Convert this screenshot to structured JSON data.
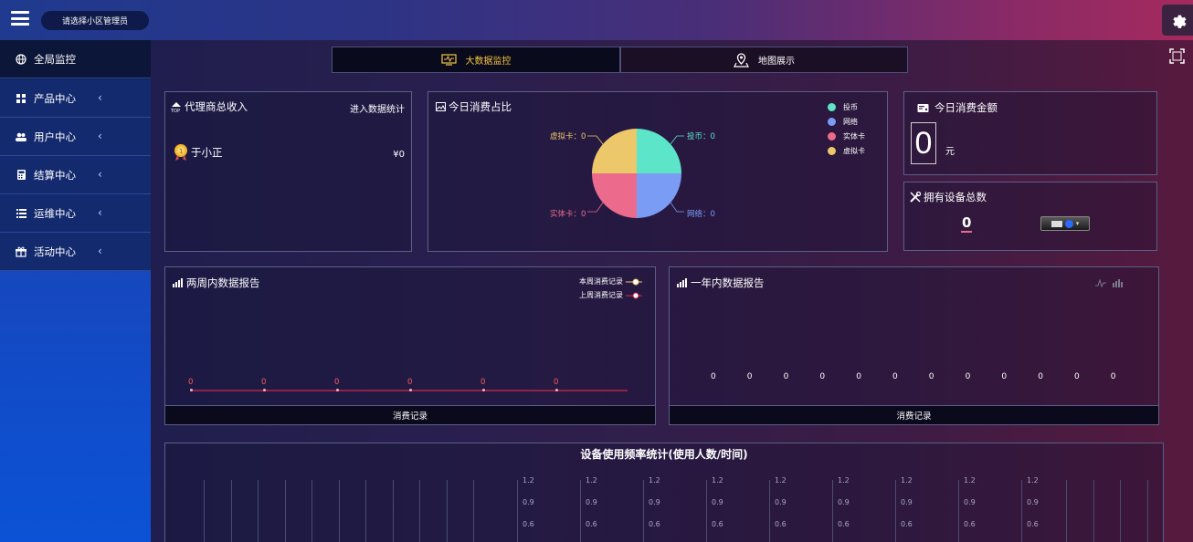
{
  "topbar": {
    "community_select": "请选择小区管理员"
  },
  "sidebar": {
    "items": [
      {
        "label": "全局监控",
        "icon": "globe-icon"
      },
      {
        "label": "产品中心",
        "icon": "grid-icon"
      },
      {
        "label": "用户中心",
        "icon": "users-icon"
      },
      {
        "label": "结算中心",
        "icon": "calculator-icon"
      },
      {
        "label": "运维中心",
        "icon": "list-icon"
      },
      {
        "label": "活动中心",
        "icon": "gift-icon"
      }
    ]
  },
  "tabs": [
    {
      "label": "大数据监控",
      "icon": "monitor-icon"
    },
    {
      "label": "地图展示",
      "icon": "map-pin-icon"
    }
  ],
  "agent_income": {
    "title": "代理商总收入",
    "link": "进入数据统计",
    "name": "于小正",
    "amount": "¥0"
  },
  "consumption_share": {
    "title": "今日消费占比",
    "legend": [
      {
        "name": "投币",
        "color": "#5ce5c8"
      },
      {
        "name": "网络",
        "color": "#7b9cf5"
      },
      {
        "name": "实体卡",
        "color": "#ec6a8c"
      },
      {
        "name": "虚拟卡",
        "color": "#ecc86a"
      }
    ],
    "labels": {
      "coin": "投币：0",
      "net": "网络：0",
      "card": "实体卡：0",
      "virtual": "虚拟卡：0"
    }
  },
  "today_amount": {
    "title": "今日消费金额",
    "value": "0",
    "unit": "元"
  },
  "device_total": {
    "title": "拥有设备总数",
    "value": "0"
  },
  "two_week": {
    "title": "两周内数据报告",
    "legend": [
      "本周消费记录",
      "上周消费记录"
    ],
    "footer": "消费记录",
    "points": [
      "0",
      "0",
      "0",
      "0",
      "0",
      "0"
    ]
  },
  "one_year": {
    "title": "一年内数据报告",
    "footer": "消费记录",
    "points": [
      "0",
      "0",
      "0",
      "0",
      "0",
      "0",
      "0",
      "0",
      "0",
      "0",
      "0",
      "0"
    ]
  },
  "usage": {
    "title": "设备使用频率统计(使用人数/时间)",
    "ticks": [
      "1.2",
      "0.9",
      "0.6"
    ]
  },
  "chart_data": [
    {
      "type": "pie",
      "title": "今日消费占比",
      "categories": [
        "投币",
        "网络",
        "实体卡",
        "虚拟卡"
      ],
      "values": [
        0,
        0,
        0,
        0
      ]
    },
    {
      "type": "line",
      "title": "两周内数据报告",
      "series": [
        {
          "name": "本周消费记录",
          "values": [
            0,
            0,
            0,
            0,
            0,
            0
          ]
        },
        {
          "name": "上周消费记录",
          "values": []
        }
      ],
      "xlabel": "消费记录"
    },
    {
      "type": "line",
      "title": "一年内数据报告",
      "series": [
        {
          "name": "",
          "values": [
            0,
            0,
            0,
            0,
            0,
            0,
            0,
            0,
            0,
            0,
            0,
            0
          ]
        }
      ],
      "xlabel": "消费记录"
    }
  ]
}
